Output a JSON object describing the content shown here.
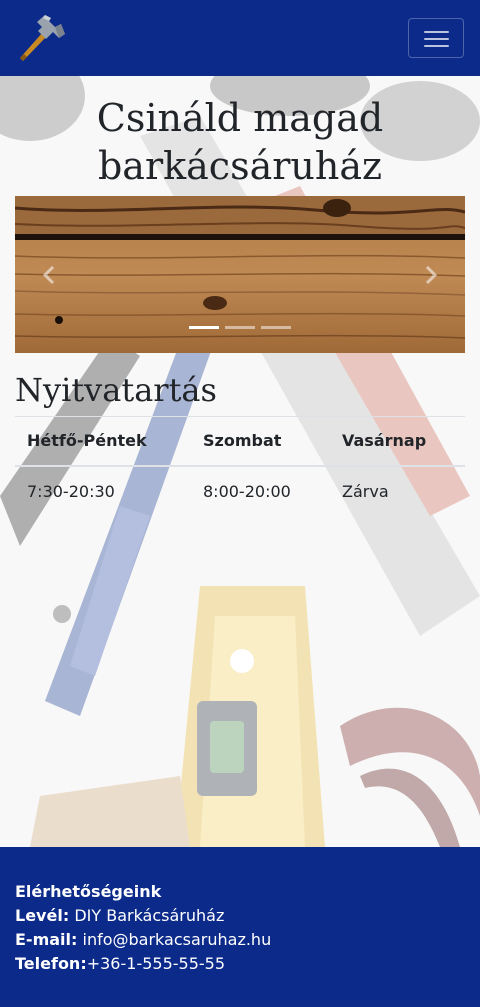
{
  "header": {
    "logo_icon": "hammer-icon",
    "toggle_icon": "hamburger-menu-icon",
    "brand_color": "#0b2a8a"
  },
  "hero": {
    "title": "Csináld magad barkácsáruház"
  },
  "carousel": {
    "prev_icon": "chevron-left-icon",
    "next_icon": "chevron-right-icon",
    "slide_count": 3,
    "active_slide": 1
  },
  "hours": {
    "title": "Nyitvatartás",
    "columns": [
      "Hétfő-Péntek",
      "Szombat",
      "Vasárnap"
    ],
    "rows": [
      [
        "7:30-20:30",
        "8:00-20:00",
        "Zárva"
      ]
    ]
  },
  "footer": {
    "heading": "Elérhetőségeink",
    "mail_label": "Levél:",
    "mail_value": "DIY Barkácsáruház",
    "email_label": "E-mail:",
    "email_value": "info@barkacsaruhaz.hu",
    "phone_label": "Telefon:",
    "phone_value": "+36-1-555-55-55"
  }
}
